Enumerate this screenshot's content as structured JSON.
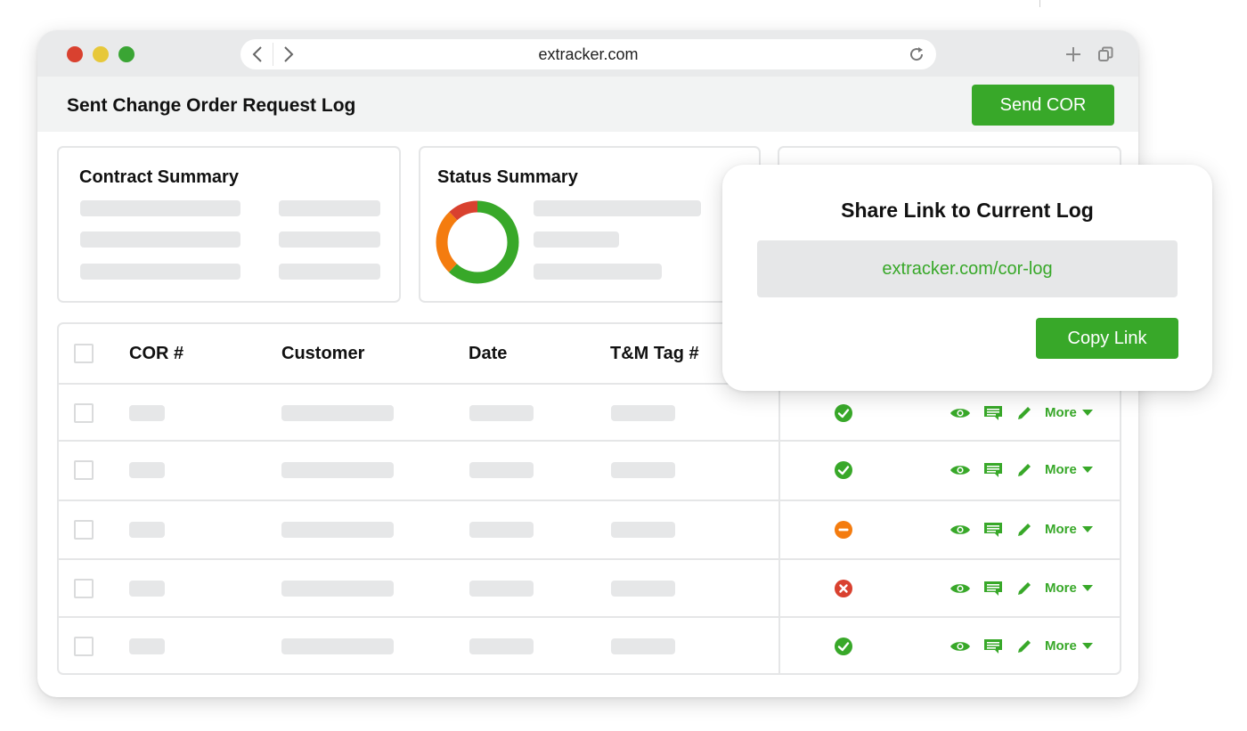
{
  "browser": {
    "url": "extracker.com",
    "traffic_lights": {
      "red": "#d9412f",
      "yellow": "#e7c83a",
      "green": "#3aa534"
    }
  },
  "header": {
    "title": "Sent Change Order Request Log",
    "send_button_label": "Send COR"
  },
  "summary": {
    "contract_title": "Contract Summary",
    "status_title": "Status Summary",
    "donut_segments": [
      {
        "status": "approved",
        "fraction": 0.62,
        "color": "#38a829"
      },
      {
        "status": "pending",
        "fraction": 0.26,
        "color": "#f47c0f"
      },
      {
        "status": "rejected",
        "fraction": 0.12,
        "color": "#d9412f"
      }
    ]
  },
  "table": {
    "columns": [
      "COR #",
      "Customer",
      "Date",
      "T&M Tag #"
    ],
    "more_label": "More",
    "rows": [
      {
        "status": "approved"
      },
      {
        "status": "approved"
      },
      {
        "status": "pending"
      },
      {
        "status": "rejected"
      },
      {
        "status": "approved"
      }
    ],
    "action_icons": [
      "eye-icon",
      "comment-icon",
      "pencil-icon"
    ]
  },
  "share_popup": {
    "title": "Share Link to Current Log",
    "link": "extracker.com/cor-log",
    "copy_button_label": "Copy Link"
  },
  "colors": {
    "accent": "#38a829",
    "approved": "#38a829",
    "pending": "#f47c0f",
    "rejected": "#d9412f",
    "placeholder": "#e6e7e8"
  }
}
